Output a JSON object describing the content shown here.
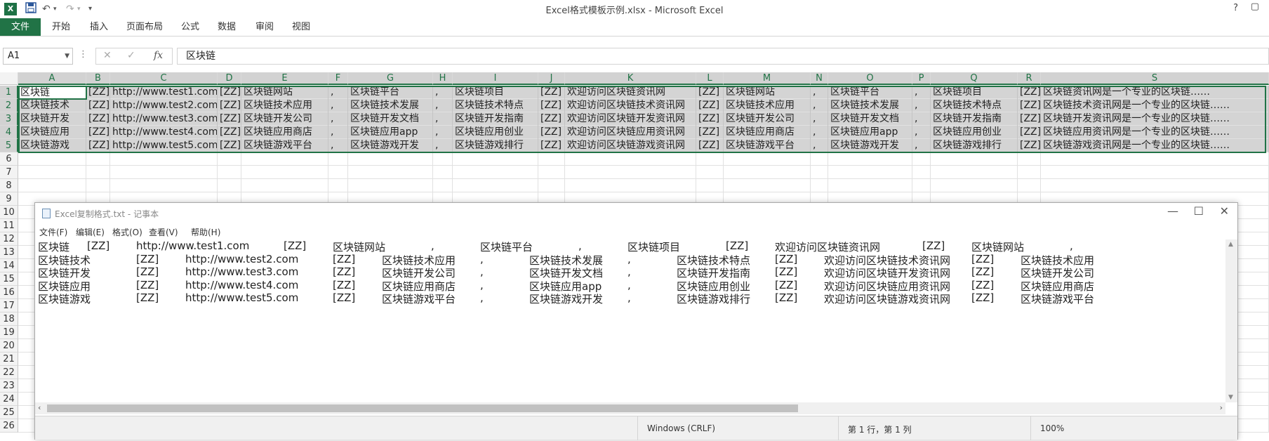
{
  "titlebar": {
    "title": "Excel格式模板示例.xlsx - Microsoft Excel",
    "help": "?",
    "restore": "▢",
    "close_label": "×"
  },
  "ribbon": {
    "file": "文件",
    "tabs": [
      "开始",
      "插入",
      "页面布局",
      "公式",
      "数据",
      "审阅",
      "视图"
    ]
  },
  "formula_bar": {
    "name_box": "A1",
    "fx": "fx",
    "value": "区块链"
  },
  "columns": [
    "A",
    "B",
    "C",
    "D",
    "E",
    "F",
    "G",
    "H",
    "I",
    "J",
    "K",
    "L",
    "M",
    "N",
    "O",
    "P",
    "Q",
    "R",
    "S"
  ],
  "row_numbers": [
    "1",
    "2",
    "3",
    "4",
    "5",
    "6",
    "7",
    "8",
    "9",
    "10",
    "11",
    "12",
    "13",
    "14",
    "15",
    "16",
    "17",
    "18",
    "19",
    "20",
    "21",
    "22",
    "23",
    "24",
    "25",
    "26"
  ],
  "rows": [
    [
      "区块链",
      "[ZZ]",
      "http://www.test1.com",
      "[ZZ]",
      "区块链网站",
      ",",
      "区块链平台",
      ",",
      "区块链项目",
      "[ZZ]",
      "欢迎访问区块链资讯网",
      "[ZZ]",
      "区块链网站",
      ",",
      "区块链平台",
      ",",
      "区块链项目",
      "[ZZ]",
      "区块链资讯网是一个专业的区块链……"
    ],
    [
      "区块链技术",
      "[ZZ]",
      "http://www.test2.com",
      "[ZZ]",
      "区块链技术应用",
      ",",
      "区块链技术发展",
      ",",
      "区块链技术特点",
      "[ZZ]",
      "欢迎访问区块链技术资讯网",
      "[ZZ]",
      "区块链技术应用",
      ",",
      "区块链技术发展",
      ",",
      "区块链技术特点",
      "[ZZ]",
      "区块链技术资讯网是一个专业的区块链……"
    ],
    [
      "区块链开发",
      "[ZZ]",
      "http://www.test3.com",
      "[ZZ]",
      "区块链开发公司",
      ",",
      "区块链开发文档",
      ",",
      "区块链开发指南",
      "[ZZ]",
      "欢迎访问区块链开发资讯网",
      "[ZZ]",
      "区块链开发公司",
      ",",
      "区块链开发文档",
      ",",
      "区块链开发指南",
      "[ZZ]",
      "区块链开发资讯网是一个专业的区块链……"
    ],
    [
      "区块链应用",
      "[ZZ]",
      "http://www.test4.com",
      "[ZZ]",
      "区块链应用商店",
      ",",
      "区块链应用app",
      ",",
      "区块链应用创业",
      "[ZZ]",
      "欢迎访问区块链应用资讯网",
      "[ZZ]",
      "区块链应用商店",
      ",",
      "区块链应用app",
      ",",
      "区块链应用创业",
      "[ZZ]",
      "区块链应用资讯网是一个专业的区块链……"
    ],
    [
      "区块链游戏",
      "[ZZ]",
      "http://www.test5.com",
      "[ZZ]",
      "区块链游戏平台",
      ",",
      "区块链游戏开发",
      ",",
      "区块链游戏排行",
      "[ZZ]",
      "欢迎访问区块链游戏资讯网",
      "[ZZ]",
      "区块链游戏平台",
      ",",
      "区块链游戏开发",
      ",",
      "区块链游戏排行",
      "[ZZ]",
      "区块链游戏资讯网是一个专业的区块链……"
    ]
  ],
  "notepad": {
    "title": "Excel复制格式.txt - 记事本",
    "menu": [
      "文件(F)",
      "编辑(E)",
      "格式(O)",
      "查看(V)",
      "帮助(H)"
    ],
    "lines": [
      [
        "区块链",
        "[ZZ]",
        "http://www.test1.com",
        "[ZZ]",
        "区块链网站",
        ",",
        "区块链平台",
        ",",
        "区块链项目",
        "[ZZ]",
        "欢迎访问区块链资讯网",
        "[ZZ]",
        "区块链网站",
        ","
      ],
      [
        "区块链技术",
        "[ZZ]",
        "http://www.test2.com",
        "[ZZ]",
        "区块链技术应用",
        ",",
        "区块链技术发展",
        ",",
        "区块链技术特点",
        "[ZZ]",
        "欢迎访问区块链技术资讯网",
        "[ZZ]",
        "区块链技术应用"
      ],
      [
        "区块链开发",
        "[ZZ]",
        "http://www.test3.com",
        "[ZZ]",
        "区块链开发公司",
        ",",
        "区块链开发文档",
        ",",
        "区块链开发指南",
        "[ZZ]",
        "欢迎访问区块链开发资讯网",
        "[ZZ]",
        "区块链开发公司"
      ],
      [
        "区块链应用",
        "[ZZ]",
        "http://www.test4.com",
        "[ZZ]",
        "区块链应用商店",
        ",",
        "区块链应用app",
        ",",
        "区块链应用创业",
        "[ZZ]",
        "欢迎访问区块链应用资讯网",
        "[ZZ]",
        "区块链应用商店"
      ],
      [
        "区块链游戏",
        "[ZZ]",
        "http://www.test5.com",
        "[ZZ]",
        "区块链游戏平台",
        ",",
        "区块链游戏开发",
        ",",
        "区块链游戏排行",
        "[ZZ]",
        "欢迎访问区块链游戏资讯网",
        "[ZZ]",
        "区块链游戏平台"
      ]
    ],
    "status": {
      "encoding": "Windows (CRLF)",
      "position": "第 1 行，第 1 列",
      "zoom": "100%"
    }
  },
  "colors": {
    "excel_green": "#217346",
    "selection_fill": "#d4d4d4"
  }
}
